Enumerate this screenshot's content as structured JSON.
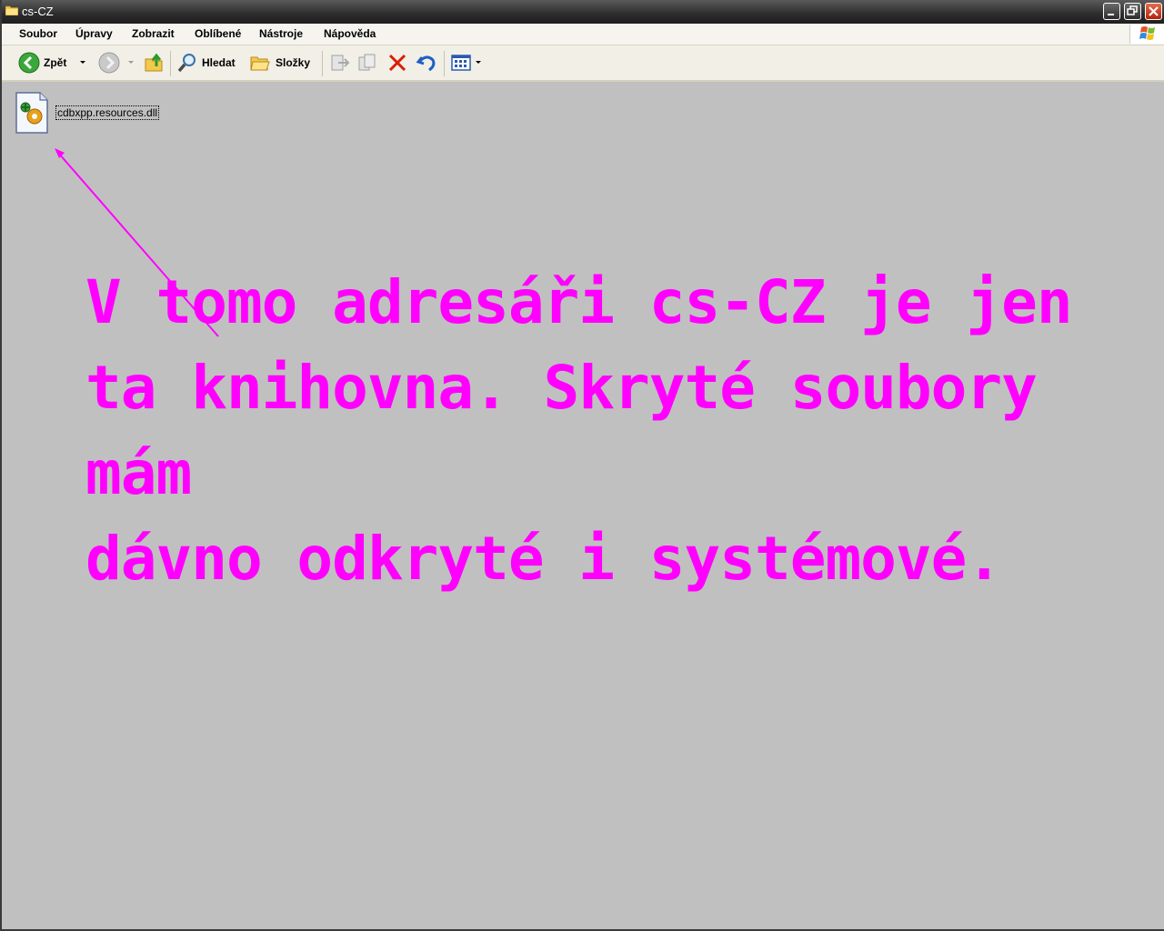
{
  "window": {
    "title": "cs-CZ"
  },
  "menu": {
    "items": [
      "Soubor",
      "Úpravy",
      "Zobrazit",
      "Oblíbené",
      "Nástroje",
      "Nápověda"
    ]
  },
  "toolbar": {
    "back_label": "Zpět",
    "search_label": "Hledat",
    "folders_label": "Složky"
  },
  "files": [
    {
      "name": "cdbxpp.resources.dll",
      "icon": "dll-file-icon"
    }
  ],
  "annotation": {
    "lines": [
      "V tomo adresáři cs-CZ je jen",
      "ta knihovna. Skryté soubory mám",
      "dávno odkryté i systémové."
    ],
    "color": "#ff00ff"
  }
}
